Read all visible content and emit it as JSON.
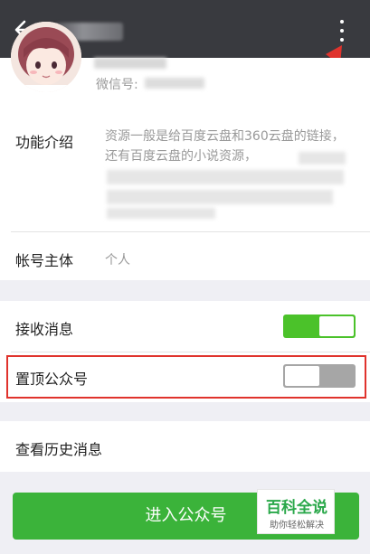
{
  "header": {
    "back_icon": "back-arrow-icon",
    "more_icon": "more-vertical-icon"
  },
  "profile": {
    "wechat_id_label": "微信号:"
  },
  "intro": {
    "label": "功能介绍",
    "text": "资源一般是给百度云盘和360云盘的链接，还有百度云盘的小说资源，"
  },
  "account": {
    "label": "帐号主体",
    "value": "个人"
  },
  "settings": {
    "receive_messages": {
      "label": "接收消息",
      "enabled": true
    },
    "pin_account": {
      "label": "置顶公众号",
      "enabled": false
    }
  },
  "history": {
    "label": "查看历史消息"
  },
  "enter_button": {
    "label": "进入公众号"
  },
  "watermark": {
    "title": "百科全说",
    "subtitle": "助你轻松解决"
  },
  "colors": {
    "topbar": "#393a3f",
    "toggle_on": "#4bc22a",
    "toggle_off": "#a6a6a6",
    "button": "#3bb33a",
    "highlight": "#e0332d"
  }
}
